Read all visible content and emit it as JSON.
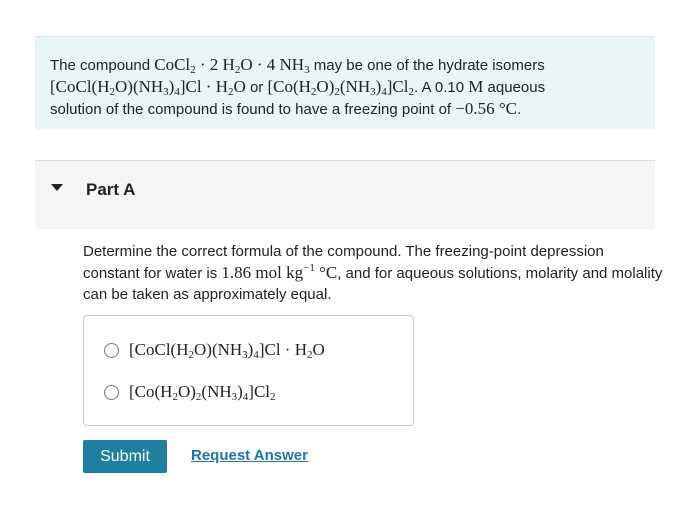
{
  "intro": {
    "t1": "The compound ",
    "t2": " may be one of the hydrate isomers",
    "or": " or ",
    "t3": ". A 0.10 ",
    "t4": " aqueous",
    "t5": "solution of the compound is found to have a freezing point of ",
    "t6": "."
  },
  "part": {
    "title": "Part A"
  },
  "question": {
    "t1": "Determine the correct formula of the compound. The freezing-point depression constant for water is ",
    "t2": ", and for aqueous solutions, molarity and molality can be taken as approximately equal."
  },
  "options": [
    {
      "label": "[CoCl(H2O)(NH3)4]Cl · H2O"
    },
    {
      "label": "[Co(H2O)2(NH3)4]Cl2"
    }
  ],
  "buttons": {
    "submit": "Submit",
    "request_answer": "Request Answer"
  },
  "colors": {
    "intro_bg": "#e9f5f6",
    "submit_bg": "#1e7fa0",
    "link": "#1e76a8"
  }
}
